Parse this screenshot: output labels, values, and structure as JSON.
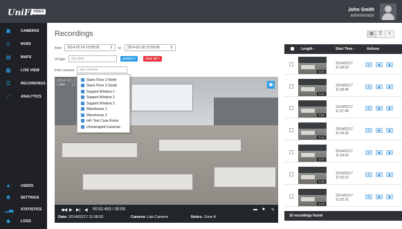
{
  "app": {
    "logo": "UniFi",
    "badge": "VIDEO",
    "user_name": "John Smith",
    "user_role": "administrator"
  },
  "nav": [
    {
      "label": "CAMERAS",
      "icon": "camera-icon"
    },
    {
      "label": "NVRS",
      "icon": "nvr-icon"
    },
    {
      "label": "MAPS",
      "icon": "map-icon"
    },
    {
      "label": "LIVE VIEW",
      "icon": "grid-icon"
    },
    {
      "label": "RECORDINGS",
      "icon": "recordings-icon"
    },
    {
      "label": "ANALYTICS",
      "icon": "analytics-icon"
    }
  ],
  "nav_bottom": [
    {
      "label": "USERS",
      "icon": "users-icon"
    },
    {
      "label": "SETTINGS",
      "icon": "settings-icon"
    },
    {
      "label": "STATISTICS",
      "icon": "statistics-icon"
    },
    {
      "label": "LOGS",
      "icon": "logs-icon"
    }
  ],
  "page": {
    "title": "Recordings",
    "from_label": "from",
    "to_label": "to",
    "from_value": "2014-02-14 12:59:59",
    "to_value": "2014-02-18 12:59:59",
    "type_label": "of type",
    "type_placeholder": "any type",
    "tag_motion": "motion ×",
    "tag_clear": "clear all ×",
    "camera_label": "from camera",
    "camera_placeholder": "any camera"
  },
  "cameras": [
    "Stairs Floor 2 North",
    "Stairs Floor 2 South",
    "Support Window 1",
    "Support Window 2",
    "Support Window 3",
    "Warehouse 1",
    "Warehouse 2",
    "mFi Test Case Room",
    "Unmanaged Cameras"
  ],
  "video": {
    "overlay_line1": "2014-02-1",
    "overlay_line2": "CAM0 - 12",
    "time": "00:52.453 / 00:09",
    "date_label": "Date:",
    "date_value": "2014/02/17 11:58:53",
    "camera_label": "Camera:",
    "camera_value": "Lab Camera",
    "notes_label": "Notes:",
    "notes_value": "Zone A"
  },
  "list": {
    "col_length": "Length ↕",
    "col_start": "Start Time ↕",
    "col_actions": "Actions",
    "footer": "10 recordings found",
    "rows": [
      {
        "duration": "0:24",
        "start": "2014/02/17\n11:58:53"
      },
      {
        "duration": "0:14",
        "start": "2014/02/17\n11:58:46"
      },
      {
        "duration": "0:24",
        "start": "2014/02/17\n11:57:46"
      },
      {
        "duration": "0:14",
        "start": "2014/02/17\n11:54:32"
      },
      {
        "duration": "0:24",
        "start": "2014/02/17\n11:54:02"
      },
      {
        "duration": "0:19",
        "start": "2014/02/17\n11:53:32"
      },
      {
        "duration": "0:24",
        "start": "2014/02/17\n11:52:21"
      }
    ]
  },
  "colors": {
    "accent": "#2b9ee6",
    "danger": "#e8323f",
    "sidebar": "#1f2127",
    "topbar": "#3b3e45"
  }
}
